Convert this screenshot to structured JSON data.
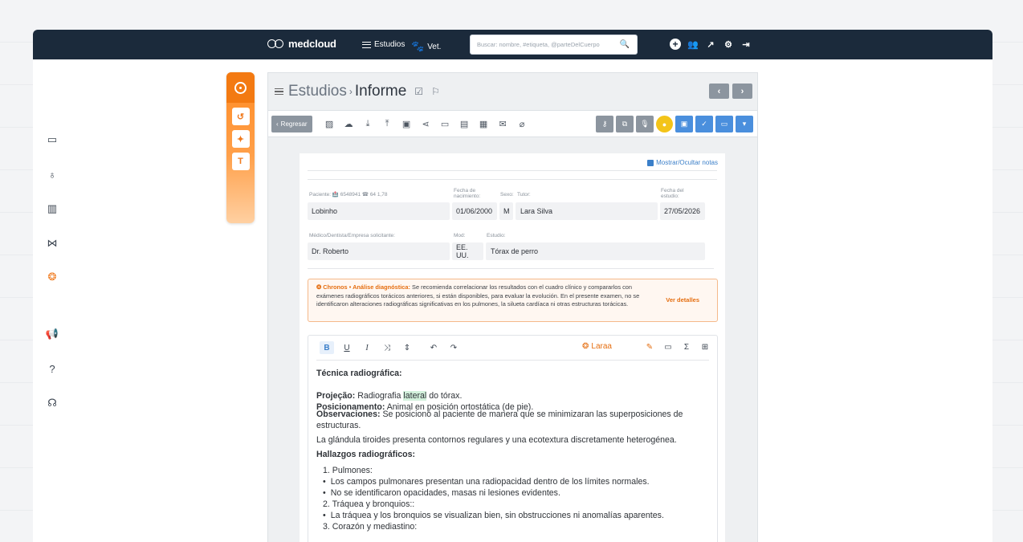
{
  "nav": {
    "brand": "medcloud",
    "studies": "Estudios",
    "vet": "Vet.",
    "search_placeholder": "Buscar: nombre, #etiqueta, @parteDelCuerpo"
  },
  "panel": {
    "crumb_root": "Estudios",
    "crumb_current": "Informe",
    "back_label": "Regresar"
  },
  "doc": {
    "notes_toggle": "Mostrar/Ocultar notas",
    "labels": {
      "patient": "Paciente: 🏥 6548941 ☎ 64 1,78",
      "birth": "Fecha de nacimiento:",
      "sex": "Sexo:",
      "tutor": "Tutor:",
      "study_date": "Fecha del estudio:",
      "doctor": "Médico/Dentista/Empresa solicitante:",
      "mod": "Mod:",
      "study": "Estudio:"
    },
    "values": {
      "patient": "Lobinho",
      "birth": "01/06/2000",
      "sex": "M",
      "tutor": "Lara Silva",
      "study_date": "27/05/2026",
      "doctor": "Dr. Roberto",
      "mod": "EE. UU.",
      "study": "Tórax de perro"
    },
    "alert": {
      "source": "Chronos • Análise diagnóstica:",
      "text": "Se recomienda correlacionar los resultados con el cuadro clínico y compararlos con exámenes radiográficos torácicos anteriores, si están disponibles, para evaluar la evolución. En el presente examen, no se identificaron alteraciones radiográficas significativas en los pulmones, la silueta cardíaca ni otras estructuras torácicas.",
      "more": "Ver detalles"
    },
    "editor": {
      "assistant": "Laraa",
      "heading1": "Técnica radiográfica:",
      "proj_label": "Projeção:",
      "proj_text_a": "Radiografia",
      "proj_text_hl": "lateral",
      "proj_text_b": "do tórax.",
      "pos_label": "Posicionamento:",
      "pos_text": "Animal en posición ortostática (de pie).",
      "obs_label": "Observaciones:",
      "obs_text": "Se posicionó al paciente de manera que se minimizaran las superposiciones de estructuras.",
      "thyroid": "La glándula tiroides presenta contornos regulares y una ecotextura discretamente heterogénea.",
      "heading2": "Hallazgos radiográficos:",
      "item1": "1.  Pulmones:",
      "item1_a": "Los campos pulmonares presentan una radiopacidad dentro de los límites normales.",
      "item1_b": "No se identificaron opacidades, masas ni lesiones evidentes.",
      "item2": "2.  Tráquea y bronquios::",
      "item2_a": "La tráquea y los bronquios se visualizan bien, sin obstrucciones ni anomalías aparentes.",
      "item3": "3.  Corazón y mediastino:"
    }
  }
}
